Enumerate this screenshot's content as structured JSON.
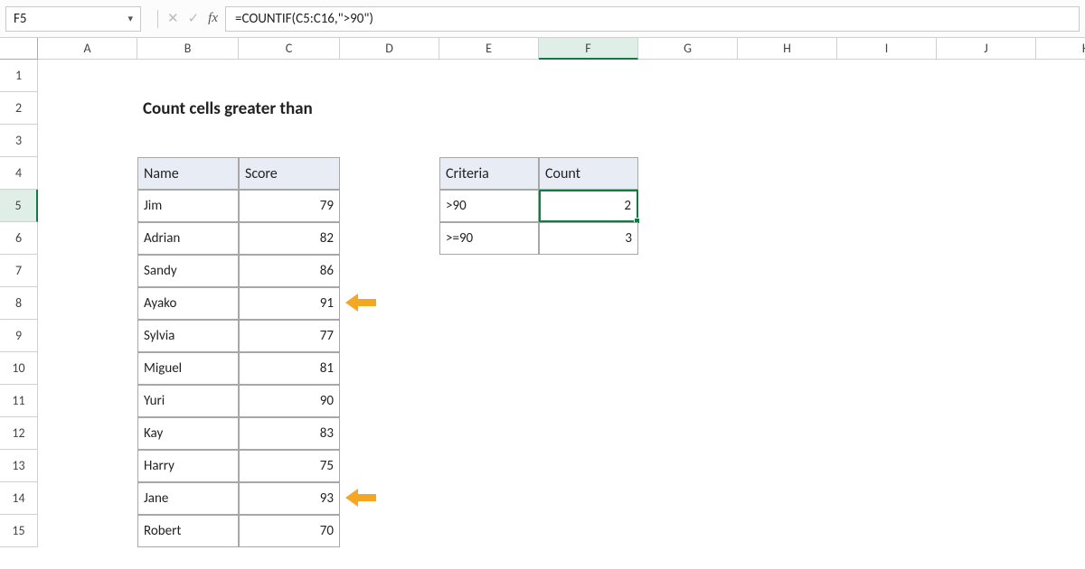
{
  "formula_bar": {
    "name_box": "F5",
    "formula": "=COUNTIF(C5:C16,\">90\")"
  },
  "columns": [
    "A",
    "B",
    "C",
    "D",
    "E",
    "F",
    "G",
    "H",
    "I",
    "J",
    "K"
  ],
  "rows": [
    "1",
    "2",
    "3",
    "4",
    "5",
    "6",
    "7",
    "8",
    "9",
    "10",
    "11",
    "12",
    "13",
    "14",
    "15"
  ],
  "title": "Count cells greater than",
  "table1": {
    "headers": {
      "name": "Name",
      "score": "Score"
    },
    "rows": [
      {
        "name": "Jim",
        "score": "79"
      },
      {
        "name": "Adrian",
        "score": "82"
      },
      {
        "name": "Sandy",
        "score": "86"
      },
      {
        "name": "Ayako",
        "score": "91"
      },
      {
        "name": "Sylvia",
        "score": "77"
      },
      {
        "name": "Miguel",
        "score": "81"
      },
      {
        "name": "Yuri",
        "score": "90"
      },
      {
        "name": "Kay",
        "score": "83"
      },
      {
        "name": "Harry",
        "score": "75"
      },
      {
        "name": "Jane",
        "score": "93"
      },
      {
        "name": "Robert",
        "score": "70"
      }
    ]
  },
  "table2": {
    "headers": {
      "criteria": "Criteria",
      "count": "Count"
    },
    "rows": [
      {
        "criteria": ">90",
        "count": "2"
      },
      {
        "criteria": ">=90",
        "count": "3"
      }
    ]
  },
  "active_cell": "F5",
  "arrow_color": "#f5a623"
}
